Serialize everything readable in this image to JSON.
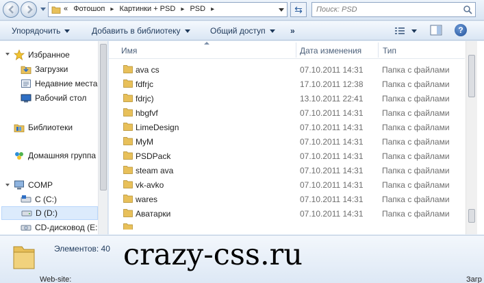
{
  "address_bar": {
    "overflow_label": "«",
    "crumbs": [
      "Фотошоп",
      "Картинки + PSD",
      "PSD"
    ],
    "search_placeholder": "Поиск: PSD"
  },
  "toolbar": {
    "organize": "Упорядочить",
    "add_to_library": "Добавить в библиотеку",
    "share": "Общий доступ",
    "more": "»",
    "help": "?"
  },
  "navigation": {
    "favorites": "Избранное",
    "downloads": "Загрузки",
    "recent": "Недавние места",
    "desktop": "Рабочий стол",
    "libraries": "Библиотеки",
    "homegroup": "Домашняя группа",
    "computer": "COMP",
    "drive_c": "C (C:)",
    "drive_d": "D (D:)",
    "cd_drive": "CD-дисковод (E:"
  },
  "columns": {
    "name": "Имя",
    "date": "Дата изменения",
    "type": "Тип"
  },
  "files": [
    {
      "name": "ava cs",
      "date": "07.10.2011 14:31",
      "type": "Папка с файлами"
    },
    {
      "name": "fdfrjc",
      "date": "17.10.2011 12:38",
      "type": "Папка с файлами"
    },
    {
      "name": "fdrjc)",
      "date": "13.10.2011 22:41",
      "type": "Папка с файлами"
    },
    {
      "name": "hbgfvf",
      "date": "07.10.2011 14:31",
      "type": "Папка с файлами"
    },
    {
      "name": "LimeDesign",
      "date": "07.10.2011 14:31",
      "type": "Папка с файлами"
    },
    {
      "name": "MyM",
      "date": "07.10.2011 14:31",
      "type": "Папка с файлами"
    },
    {
      "name": "PSDPack",
      "date": "07.10.2011 14:31",
      "type": "Папка с файлами"
    },
    {
      "name": "steam ava",
      "date": "07.10.2011 14:31",
      "type": "Папка с файлами"
    },
    {
      "name": "vk-avko",
      "date": "07.10.2011 14:31",
      "type": "Папка с файлами"
    },
    {
      "name": "wares",
      "date": "07.10.2011 14:31",
      "type": "Папка с файлами"
    },
    {
      "name": "Аватарки",
      "date": "07.10.2011 14:31",
      "type": "Папка с файлами"
    }
  ],
  "details": {
    "item_count": "Элементов: 40",
    "watermark": "crazy-css.ru"
  },
  "background_window": {
    "left_text": "Web-site:",
    "right_text": "Загр"
  },
  "colors": {
    "folder_yellow": "#e8c05a",
    "selection": "#dcebfc",
    "accent": "#1e395b"
  }
}
